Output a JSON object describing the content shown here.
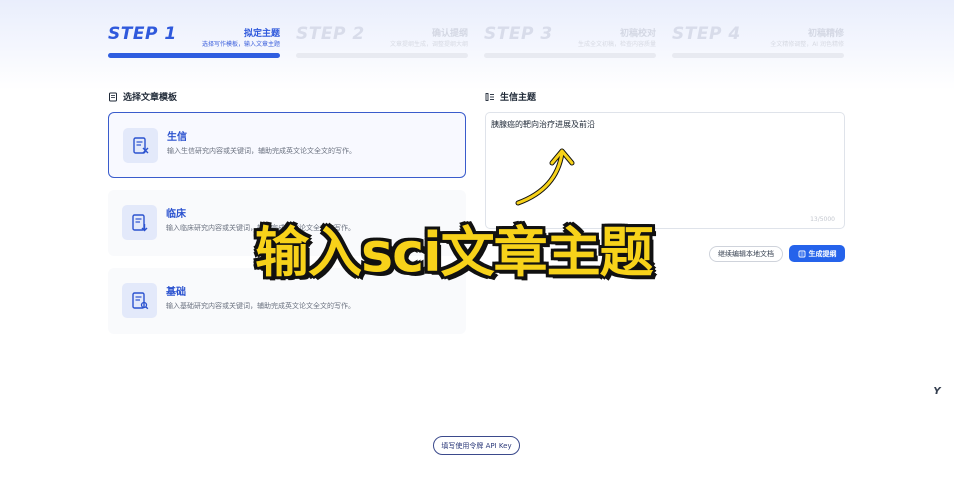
{
  "steps": [
    {
      "num": "STEP 1",
      "title": "拟定主题",
      "desc": "选择写作模板，输入文章主题",
      "state": "active"
    },
    {
      "num": "STEP 2",
      "title": "确认提纲",
      "desc": "文章提纲生成，调整提纲大纲",
      "state": "inactive"
    },
    {
      "num": "STEP 3",
      "title": "初稿校对",
      "desc": "生成全文初稿，检查内容质量",
      "state": "inactive"
    },
    {
      "num": "STEP 4",
      "title": "初稿精修",
      "desc": "全文精修调整，AI 润色精修",
      "state": "inactive"
    }
  ],
  "template_section": {
    "title": "选择文章模板",
    "icon": "document-icon"
  },
  "templates": [
    {
      "title": "生信",
      "desc": "输入生信研究内容或关键词，辅助完成英文论文全文的写作。",
      "icon": "bioinformatics-icon",
      "selected": true
    },
    {
      "title": "临床",
      "desc": "输入临床研究内容或关键词，辅助完成英文论文全文的写作。",
      "icon": "clinical-icon",
      "selected": false
    },
    {
      "title": "基础",
      "desc": "输入基础研究内容或关键词，辅助完成英文论文全文的写作。",
      "icon": "basic-research-icon",
      "selected": false
    }
  ],
  "topic_section": {
    "title": "生信主题",
    "icon": "topic-icon",
    "value": "胰腺癌的靶向治疗进展及前沿",
    "count": "13/5000"
  },
  "buttons": {
    "secondary": "继续编辑本地文档",
    "primary": "生成提纲",
    "api_key": "填写使用令牌 API Key"
  },
  "overlay_caption": "输入sci文章主题",
  "corner_logo": "Y",
  "colors": {
    "accent": "#2f5ee0",
    "caption": "#f7d21a"
  }
}
